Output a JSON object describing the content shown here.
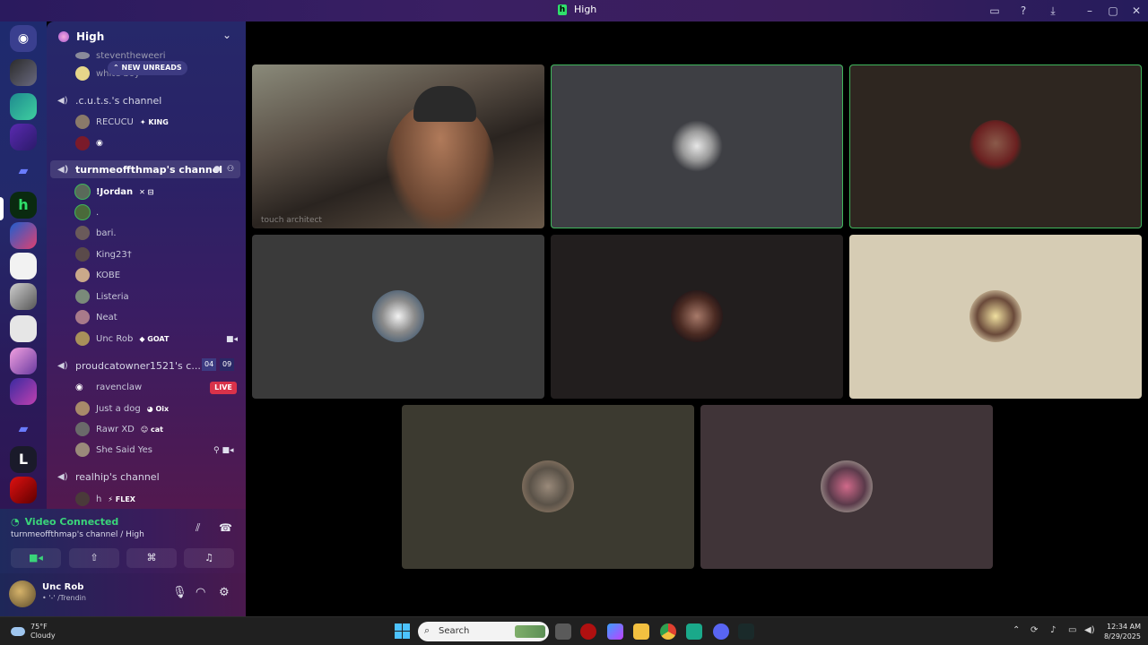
{
  "window": {
    "title": "High"
  },
  "server": {
    "name": "High",
    "new_unreads": "NEW UNREADS"
  },
  "channels": [
    {
      "name": ".c.u.t.s.'s channel",
      "members": [
        {
          "name": "RECUCU",
          "tag": "KING"
        },
        {
          "name": "",
          "tag": ""
        }
      ]
    },
    {
      "name": "turnmeoffthmap's channel",
      "active": true,
      "members": [
        {
          "name": "!Jordan"
        },
        {
          "name": "."
        },
        {
          "name": "bari."
        },
        {
          "name": "King23†"
        },
        {
          "name": "KOBE"
        },
        {
          "name": "Listeria"
        },
        {
          "name": "Neat"
        },
        {
          "name": "Unc Rob",
          "tag": "GOAT"
        }
      ]
    },
    {
      "name": "proudcatowner1521's c...",
      "counts": [
        "04",
        "09"
      ],
      "members": [
        {
          "name": "ravenclaw",
          "badge": "LIVE"
        },
        {
          "name": "Just a dog",
          "tag": "Oix"
        },
        {
          "name": "Rawr XD",
          "tag": "cat"
        },
        {
          "name": "She Said Yes"
        }
      ]
    },
    {
      "name": "realhip's channel",
      "members": [
        {
          "name": "h",
          "tag": "FLEX"
        }
      ]
    }
  ],
  "partial_top": {
    "line1": "steventheweeri",
    "line2": "white boy"
  },
  "voice": {
    "status": "Video Connected",
    "location": "turnmeoffthmap's channel / High"
  },
  "user": {
    "name": "Unc Rob",
    "status": "• '-' /Trendin"
  },
  "video": {
    "tile_caption": "touch architect"
  },
  "taskbar": {
    "weather_temp": "75°F",
    "weather_desc": "Cloudy",
    "search_placeholder": "Search",
    "time": "12:34 AM",
    "date": "8/29/2025"
  },
  "colors": {
    "speaking": "#3fb65c",
    "live": "#d9324a",
    "connected": "#3ad47a"
  }
}
